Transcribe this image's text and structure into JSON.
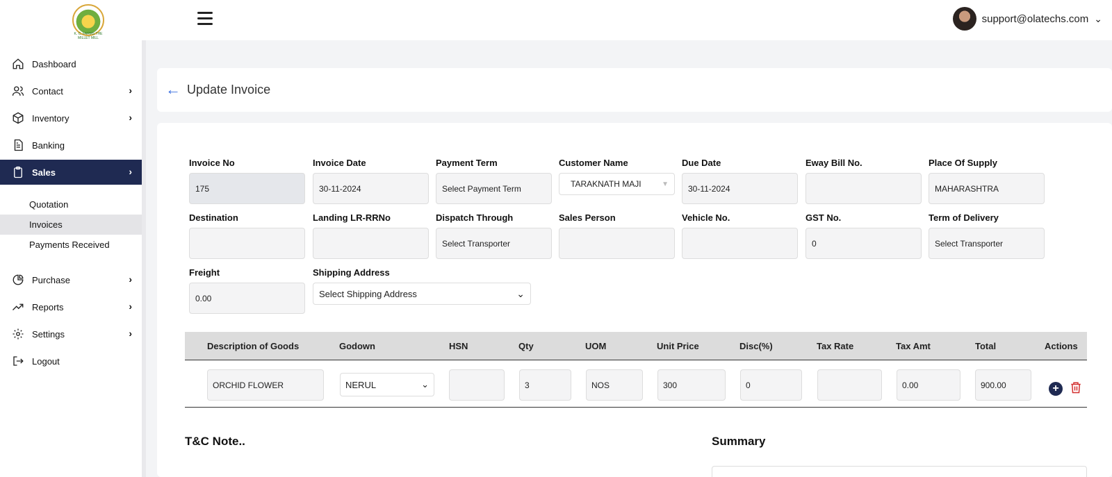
{
  "brand": {
    "logo_text": "K. C. FARMS THE MILLET MILL"
  },
  "user": {
    "email": "support@olatechs.com"
  },
  "sidebar": {
    "items": [
      {
        "label": "Dashboard",
        "icon": "home-icon"
      },
      {
        "label": "Contact",
        "icon": "users-icon"
      },
      {
        "label": "Inventory",
        "icon": "box-icon"
      },
      {
        "label": "Banking",
        "icon": "file-icon"
      },
      {
        "label": "Sales",
        "icon": "clipboard-icon"
      },
      {
        "label": "Purchase",
        "icon": "pie-chart-icon"
      },
      {
        "label": "Reports",
        "icon": "trend-icon"
      },
      {
        "label": "Settings",
        "icon": "gear-icon"
      },
      {
        "label": "Logout",
        "icon": "logout-icon"
      }
    ],
    "sales_sub": [
      "Quotation",
      "Invoices",
      "Payments Received"
    ],
    "active": "Sales",
    "selected_sub": "Invoices"
  },
  "header": {
    "title": "Update Invoice"
  },
  "form": {
    "invoice_no": {
      "label": "Invoice No",
      "value": "175"
    },
    "invoice_date": {
      "label": "Invoice Date",
      "value": "30-11-2024"
    },
    "payment_term": {
      "label": "Payment Term",
      "value": "Select Payment Term"
    },
    "customer_name": {
      "label": "Customer Name",
      "value": "TARAKNATH MAJI"
    },
    "due_date": {
      "label": "Due Date",
      "value": "30-11-2024"
    },
    "eway_bill": {
      "label": "Eway Bill No.",
      "value": ""
    },
    "place_of_supply": {
      "label": "Place Of Supply",
      "value": "MAHARASHTRA"
    },
    "destination": {
      "label": "Destination",
      "value": ""
    },
    "landing_lr": {
      "label": "Landing LR-RRNo",
      "value": ""
    },
    "dispatch_through": {
      "label": "Dispatch Through",
      "value": "Select Transporter"
    },
    "sales_person": {
      "label": "Sales Person",
      "value": ""
    },
    "vehicle_no": {
      "label": "Vehicle No.",
      "value": ""
    },
    "gst_no": {
      "label": "GST No.",
      "value": "0"
    },
    "term_of_delivery": {
      "label": "Term of Delivery",
      "value": "Select Transporter"
    },
    "freight": {
      "label": "Freight",
      "value": "0.00"
    },
    "shipping_address": {
      "label": "Shipping Address",
      "value": "Select Shipping Address"
    }
  },
  "table": {
    "headers": [
      "Description of Goods",
      "Godown",
      "HSN",
      "Qty",
      "UOM",
      "Unit Price",
      "Disc(%)",
      "Tax Rate",
      "Tax Amt",
      "Total",
      "Actions"
    ],
    "rows": [
      {
        "description": "ORCHID FLOWER",
        "godown": "NERUL",
        "hsn": "",
        "qty": "3",
        "uom": "NOS",
        "unit_price": "300",
        "disc": "0",
        "tax_rate": "",
        "tax_amt": "0.00",
        "total": "900.00"
      }
    ]
  },
  "footer": {
    "tc_label": "T&C Note..",
    "summary_label": "Summary"
  },
  "colors": {
    "accent": "#1f2a52",
    "link": "#3b6fe0",
    "danger": "#d32f2f"
  }
}
